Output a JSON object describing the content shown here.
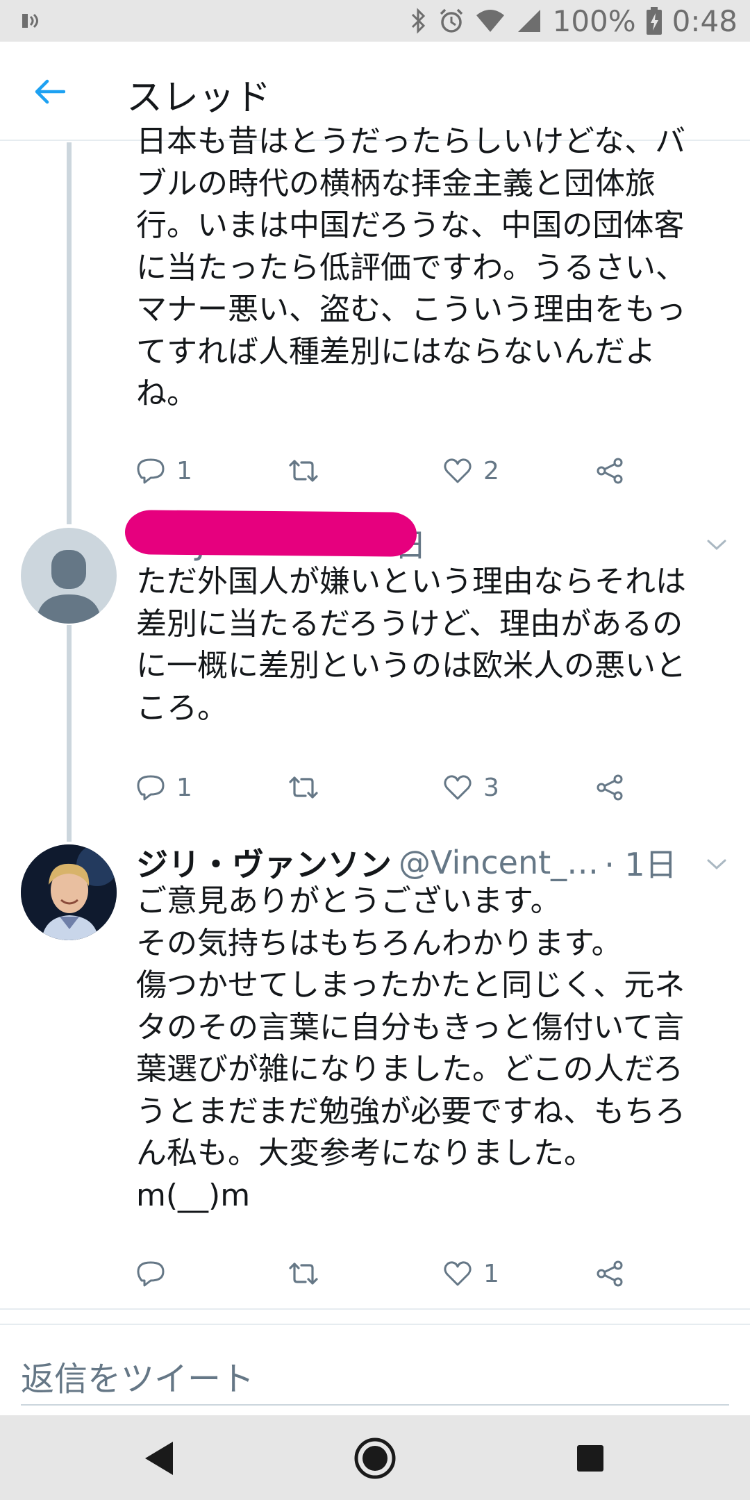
{
  "status_bar": {
    "battery_text": "100%",
    "time": "0:48",
    "icons": [
      "notification-icon",
      "bluetooth-icon",
      "alarm-icon",
      "wifi-icon",
      "signal-icon",
      "battery-charging-icon"
    ]
  },
  "header": {
    "back_icon": "back-arrow-icon",
    "title": "スレッド",
    "accent_color": "#1da1f2"
  },
  "tweets": [
    {
      "text": "日本も昔はとうだったらしいけどな、バ\nブルの時代の横柄な拝金主義と団体旅\n行。いまは中国だろうな、中国の団体客\nに当たったら低評価ですわ。うるさい、\nマナー悪い、盗む、こういう理由をもっ\nてすれば人種差別にはならないんだよ\nね。",
      "replies": "1",
      "retweets": "",
      "likes": "2"
    },
    {
      "handle_partial": "…Ja9021614",
      "time": "1日",
      "text": "ただ外国人が嫌いという理由ならそれは\n差別に当たるだろうけど、理由があるの\nに一概に差別というのは欧米人の悪いと\nころ。",
      "replies": "1",
      "retweets": "",
      "likes": "3",
      "redaction_color": "#e6007e"
    },
    {
      "name": "ジリ・ヴァンソン",
      "handle": "@Vincent_…",
      "time": "· 1日",
      "text": "ご意見ありがとうございます。\nその気持ちはもちろんわかります。\n傷つかせてしまったかたと同じく、元ネ\nタのその言葉に自分もきっと傷付いて言\n葉選びが雑になりました。どこの人だろ\nうとまだまだ勉強が必要ですね、もちろ\nん私も。大変参考になりました。\nm(__)m",
      "replies": "",
      "retweets": "",
      "likes": "1"
    }
  ],
  "reply_box": {
    "placeholder": "返信をツイート"
  },
  "nav_bar": {
    "icons": [
      "back-triangle-icon",
      "home-circle-icon",
      "recents-square-icon"
    ]
  }
}
